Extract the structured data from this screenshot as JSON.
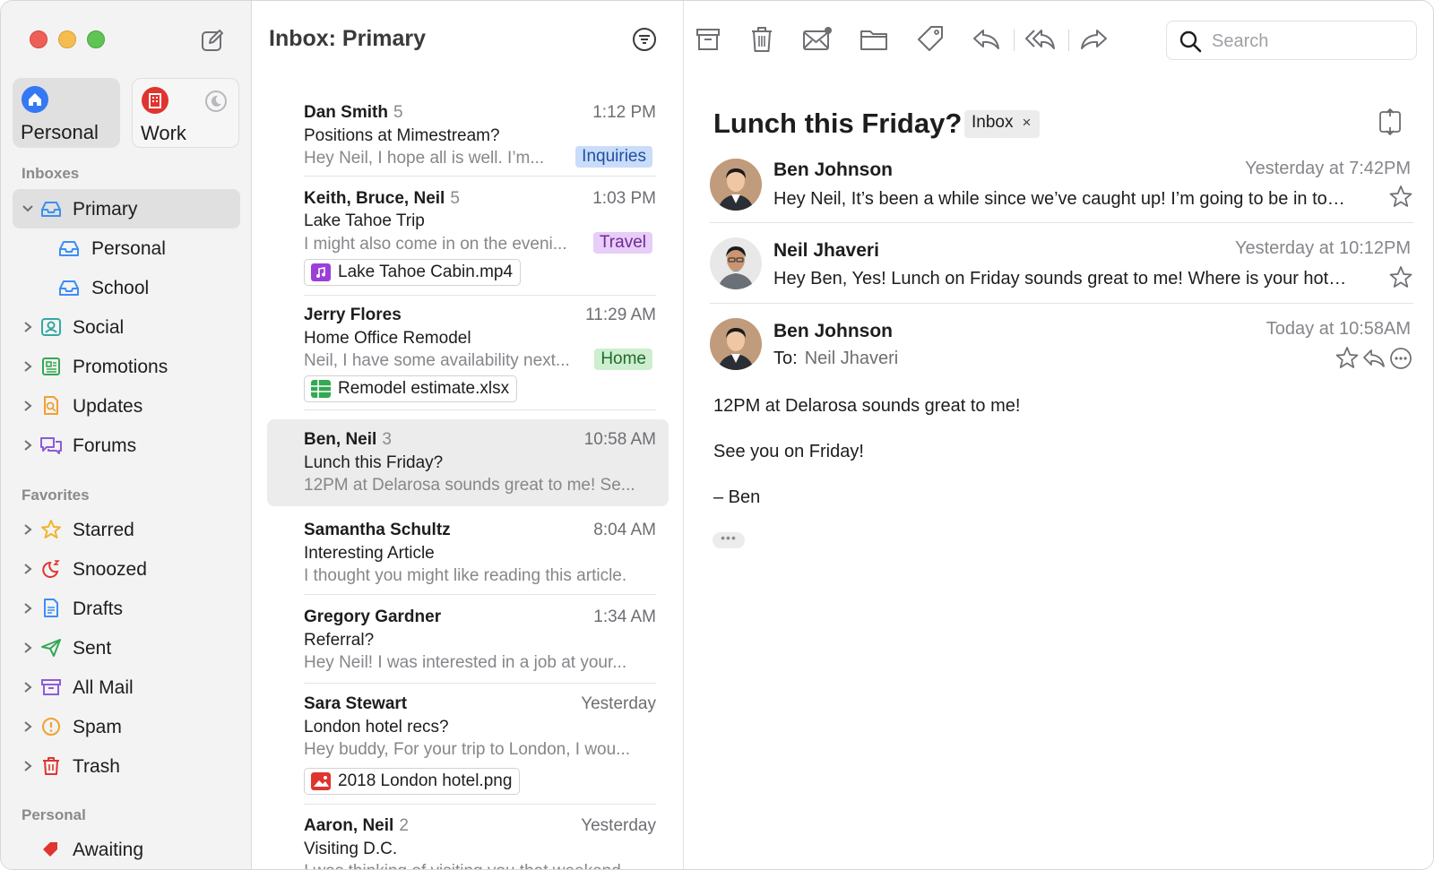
{
  "accounts": [
    {
      "label": "Personal",
      "icon": "house-icon",
      "color": "#3478f6",
      "selected": true
    },
    {
      "label": "Work",
      "icon": "building-icon",
      "color": "#e0342f",
      "selected": false
    }
  ],
  "sidebar": {
    "inboxes_heading": "Inboxes",
    "inboxes": [
      {
        "label": "Primary",
        "icon": "inbox-icon",
        "selected": true,
        "expanded": true
      },
      {
        "label": "Personal",
        "icon": "inbox-icon",
        "indent": true
      },
      {
        "label": "School",
        "icon": "inbox-icon",
        "indent": true
      },
      {
        "label": "Social",
        "icon": "people-icon"
      },
      {
        "label": "Promotions",
        "icon": "newspaper-icon"
      },
      {
        "label": "Updates",
        "icon": "document-search-icon"
      },
      {
        "label": "Forums",
        "icon": "chat-bubbles-icon"
      }
    ],
    "favorites_heading": "Favorites",
    "favorites": [
      {
        "label": "Starred",
        "icon": "star-icon"
      },
      {
        "label": "Snoozed",
        "icon": "moon-zz-icon"
      },
      {
        "label": "Drafts",
        "icon": "draft-document-icon"
      },
      {
        "label": "Sent",
        "icon": "paper-plane-icon"
      },
      {
        "label": "All Mail",
        "icon": "archive-box-icon"
      },
      {
        "label": "Spam",
        "icon": "exclamation-circle-icon"
      },
      {
        "label": "Trash",
        "icon": "trash-icon"
      }
    ],
    "personal_heading": "Personal",
    "personal": [
      {
        "label": "Awaiting",
        "icon": "tag-icon"
      }
    ]
  },
  "list": {
    "title": "Inbox: Primary",
    "messages": [
      {
        "sender": "Dan Smith",
        "count": "5",
        "time": "1:12 PM",
        "subject": "Positions at Mimestream?",
        "preview": "Hey Neil, I hope all is well. I’m...",
        "tag": "Inquiries",
        "tag_bg": "#c9dcfa",
        "tag_fg": "#1f4f9e"
      },
      {
        "sender": "Keith, Bruce, Neil",
        "count": "5",
        "time": "1:03 PM",
        "subject": "Lake Tahoe Trip",
        "preview": "I might also come in on the eveni...",
        "tag": "Travel",
        "tag_bg": "#e7cdf7",
        "tag_fg": "#6e2a96",
        "attachment": "Lake Tahoe Cabin.mp4",
        "att_icon": "music-file-icon",
        "att_color": "#9b3fd8"
      },
      {
        "sender": "Jerry Flores",
        "count": "",
        "time": "11:29 AM",
        "subject": "Home Office Remodel",
        "preview": "Neil, I have some availability next...",
        "tag": "Home",
        "tag_bg": "#cdeecf",
        "tag_fg": "#1f6b2a",
        "attachment": "Remodel estimate.xlsx",
        "att_icon": "spreadsheet-icon",
        "att_color": "#34a853"
      },
      {
        "sender": "Ben, Neil",
        "count": "3",
        "time": "10:58 AM",
        "subject": "Lunch this Friday?",
        "preview": "12PM at Delarosa sounds great to me! Se...",
        "selected": true
      },
      {
        "sender": "Samantha Schultz",
        "count": "",
        "time": "8:04 AM",
        "subject": "Interesting Article",
        "preview": "I thought you might like reading this article."
      },
      {
        "sender": "Gregory Gardner",
        "count": "",
        "time": "1:34 AM",
        "subject": "Referral?",
        "preview": "Hey Neil! I was interested in a job at your..."
      },
      {
        "sender": "Sara Stewart",
        "count": "",
        "time": "Yesterday",
        "subject": "London hotel recs?",
        "preview": "Hey buddy, For your trip to London, I wou...",
        "attachment": "2018 London hotel.png",
        "att_icon": "image-file-icon",
        "att_color": "#e0342f"
      },
      {
        "sender": "Aaron, Neil",
        "count": "2",
        "time": "Yesterday",
        "subject": "Visiting D.C.",
        "preview": "I was thinking of visiting you that weekend..."
      }
    ]
  },
  "toolbar": {
    "buttons": [
      "archive-icon",
      "trash-icon",
      "mark-unread-icon",
      "move-to-folder-icon",
      "label-tag-icon",
      "reply-icon",
      "reply-all-icon",
      "forward-icon"
    ],
    "search_placeholder": "Search"
  },
  "thread": {
    "title": "Lunch this Friday?",
    "label_chip": "Inbox",
    "label_remove": "×",
    "messages": [
      {
        "name": "Ben Johnson",
        "when": "Yesterday at 7:42PM",
        "snippet": "Hey Neil, It’s been a while since we’ve caught up! I’m going to be in town next week and wanted to grab lunch..."
      },
      {
        "name": "Neil Jhaveri",
        "when": "Yesterday at 10:12PM",
        "snippet": "Hey Ben, Yes! Lunch on Friday sounds great to me! Where is your hotel? I know a few good spots..."
      },
      {
        "name": "Ben Johnson",
        "when": "Today at 10:58AM",
        "to_label": "To:",
        "to": "Neil Jhaveri"
      }
    ],
    "body": [
      "12PM at Delarosa sounds great to me!",
      "See you on Friday!",
      "– Ben"
    ],
    "more": "•••"
  },
  "colors": {
    "accent": "#3478f6",
    "sidebar_icon_blue": "#3d8ef5",
    "sidebar_icon_green": "#34a853",
    "sidebar_icon_orange": "#f0a131",
    "sidebar_icon_purple": "#8e5bd8"
  }
}
